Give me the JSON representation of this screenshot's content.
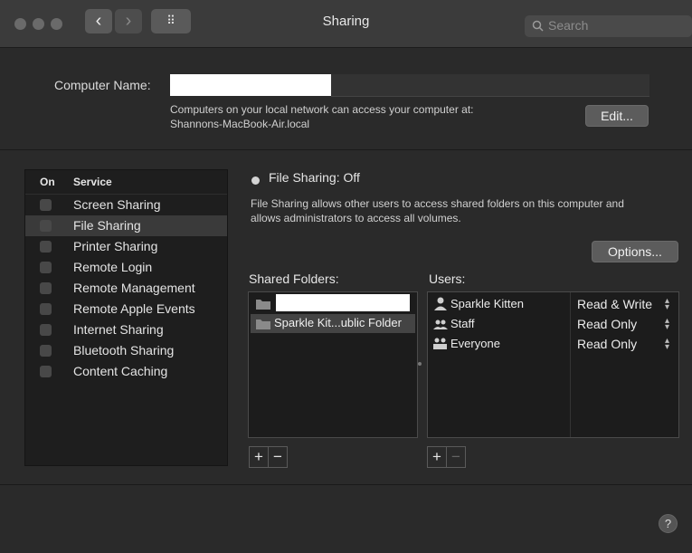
{
  "window": {
    "title": "Sharing"
  },
  "toolbar": {
    "back": "‹",
    "forward": "›",
    "grid": "⠿",
    "search_placeholder": "Search"
  },
  "computer_name": {
    "label": "Computer Name:",
    "value": "",
    "info_line1": "Computers on your local network can access your computer at:",
    "info_line2": "Shannons-MacBook-Air.local",
    "edit_label": "Edit..."
  },
  "services": {
    "header_on": "On",
    "header_service": "Service",
    "items": [
      {
        "label": "Screen Sharing",
        "checked": false,
        "selected": false
      },
      {
        "label": "File Sharing",
        "checked": false,
        "selected": true
      },
      {
        "label": "Printer Sharing",
        "checked": false,
        "selected": false
      },
      {
        "label": "Remote Login",
        "checked": false,
        "selected": false
      },
      {
        "label": "Remote Management",
        "checked": false,
        "selected": false
      },
      {
        "label": "Remote Apple Events",
        "checked": false,
        "selected": false
      },
      {
        "label": "Internet Sharing",
        "checked": false,
        "selected": false
      },
      {
        "label": "Bluetooth Sharing",
        "checked": false,
        "selected": false
      },
      {
        "label": "Content Caching",
        "checked": false,
        "selected": false
      }
    ]
  },
  "file_sharing": {
    "status": "File Sharing: Off",
    "desc_line1": "File Sharing allows other users to access shared folders on this computer and",
    "desc_line2": "allows administrators to access all volumes.",
    "options_label": "Options...",
    "shared_folders_label": "Shared Folders:",
    "folders": [
      {
        "name": "",
        "selected": false
      },
      {
        "name": "Sparkle Kit...ublic Folder",
        "selected": true
      }
    ],
    "users_label": "Users:",
    "users": [
      {
        "name": "Sparkle Kitten",
        "permission": "Read & Write",
        "icon": "single-user-icon"
      },
      {
        "name": "Staff",
        "permission": "Read Only",
        "icon": "group-icon"
      },
      {
        "name": "Everyone",
        "permission": "Read Only",
        "icon": "everyone-icon"
      }
    ],
    "plus": "+",
    "minus": "−"
  },
  "help": "?"
}
